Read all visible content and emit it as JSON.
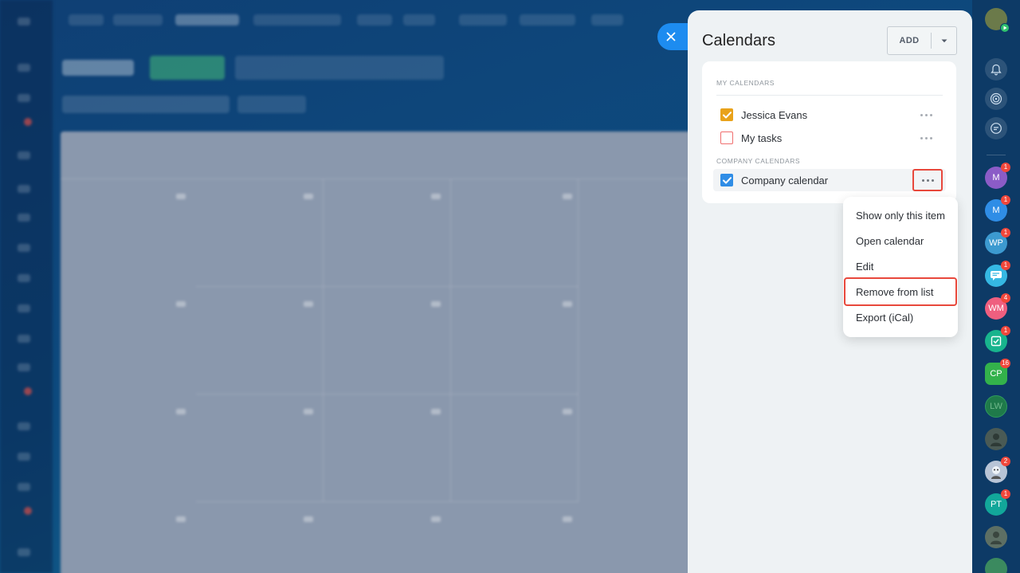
{
  "panel": {
    "title": "Calendars",
    "add_label": "ADD"
  },
  "sections": {
    "my_calendars": "MY CALENDARS",
    "company_calendars": "COMPANY CALENDARS"
  },
  "calendars": [
    {
      "label": "Jessica Evans",
      "checked": true,
      "color": "#e9a21a"
    },
    {
      "label": "My tasks",
      "checked": false,
      "color": "#f06e6e"
    },
    {
      "label": "Company calendar",
      "checked": true,
      "color": "#2f8de6"
    }
  ],
  "context_menu": {
    "items": [
      "Show only this item",
      "Open calendar",
      "Edit",
      "Remove from list",
      "Export (iCal)"
    ],
    "highlighted": "Remove from list"
  },
  "right_rail": {
    "contacts": [
      {
        "initials": "M",
        "badge": "1",
        "color": "#8b5cc7"
      },
      {
        "initials": "M",
        "badge": "1",
        "color": "#2f8de6"
      },
      {
        "initials": "WP",
        "badge": "1",
        "color": "#3c9ad0"
      },
      {
        "initials": "",
        "badge": "1",
        "color": "#35b8e3",
        "icon": "chat-icon"
      },
      {
        "initials": "WM",
        "badge": "4",
        "color": "#ef5f7f"
      },
      {
        "initials": "",
        "badge": "1",
        "color": "#18b48d",
        "icon": "task-icon"
      },
      {
        "initials": "CP",
        "badge": "16",
        "color": "#33b24b"
      },
      {
        "initials": "LW",
        "badge": "",
        "color": "#1f7a4a"
      },
      {
        "initials": "",
        "badge": "",
        "color": "#4a5a55",
        "icon": "user-photo"
      },
      {
        "initials": "",
        "badge": "2",
        "color": "#b8c4d6",
        "icon": "user-photo"
      },
      {
        "initials": "PT",
        "badge": "1",
        "color": "#12a79a"
      },
      {
        "initials": "",
        "badge": "",
        "color": "#5d6f64",
        "icon": "user-photo"
      }
    ]
  },
  "colors": {
    "accent": "#1d8cf0",
    "highlight": "#e8483c"
  }
}
